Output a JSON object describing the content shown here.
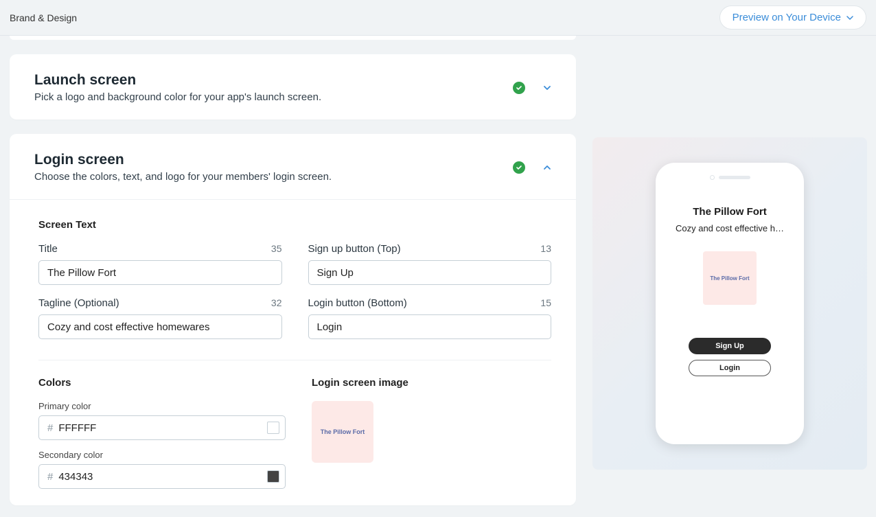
{
  "header": {
    "title": "Brand & Design",
    "preview_button": "Preview on Your Device"
  },
  "cards": {
    "launch": {
      "title": "Launch screen",
      "subtitle": "Pick a logo and background color for your app's launch screen."
    },
    "login": {
      "title": "Login screen",
      "subtitle": "Choose the colors, text, and logo for your members' login screen."
    }
  },
  "screen_text": {
    "section_label": "Screen Text",
    "title_label": "Title",
    "title_value": "The Pillow Fort",
    "title_counter": "35",
    "tagline_label": "Tagline (Optional)",
    "tagline_value": "Cozy and cost effective homewares",
    "tagline_counter": "32",
    "signup_label": "Sign up button (Top)",
    "signup_value": "Sign Up",
    "signup_counter": "13",
    "loginbtn_label": "Login button (Bottom)",
    "loginbtn_value": "Login",
    "loginbtn_counter": "15"
  },
  "colors": {
    "section_label": "Colors",
    "primary_label": "Primary color",
    "primary_value": "FFFFFF",
    "secondary_label": "Secondary color",
    "secondary_value": "434343"
  },
  "image": {
    "section_label": "Login screen image",
    "thumb_text": "The Pillow Fort"
  },
  "preview": {
    "title": "The Pillow Fort",
    "tagline": "Cozy and cost effective h…",
    "logo_text": "The Pillow Fort",
    "signup": "Sign Up",
    "login": "Login"
  }
}
